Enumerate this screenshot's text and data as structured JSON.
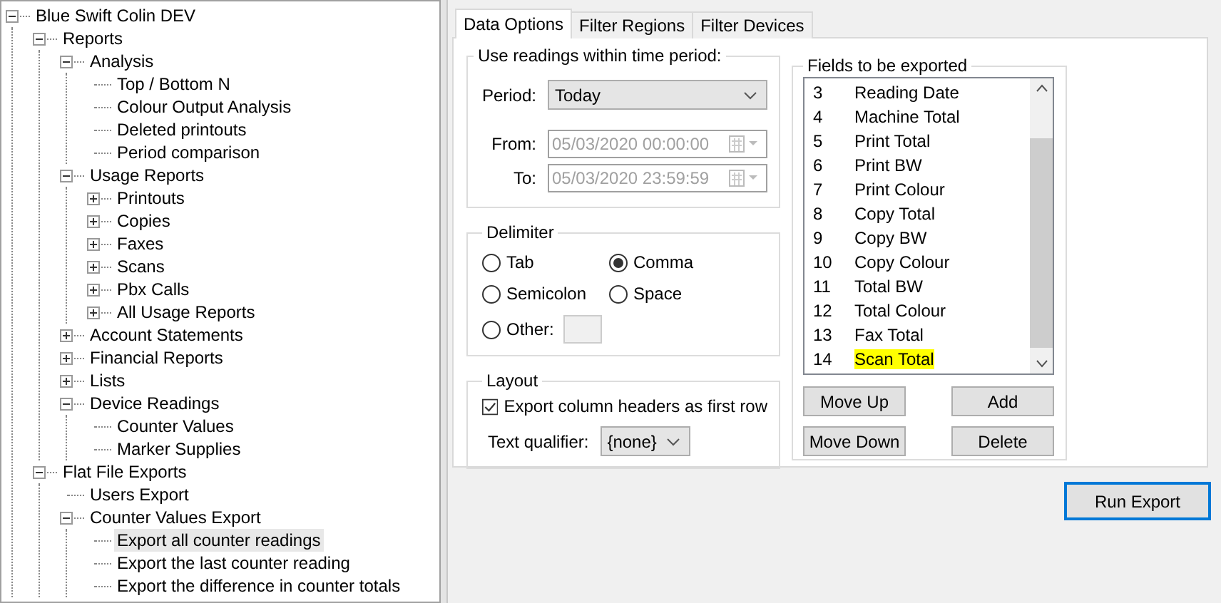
{
  "tree": {
    "label": "Blue Swift Colin DEV",
    "expanded": true,
    "selected": false,
    "children": [
      {
        "label": "Reports",
        "expanded": true,
        "selected": false,
        "children": [
          {
            "label": "Analysis",
            "expanded": true,
            "selected": false,
            "children": [
              {
                "label": "Top / Bottom N",
                "selected": false
              },
              {
                "label": "Colour Output Analysis",
                "selected": false
              },
              {
                "label": "Deleted printouts",
                "selected": false
              },
              {
                "label": "Period comparison",
                "selected": false
              }
            ]
          },
          {
            "label": "Usage Reports",
            "expanded": true,
            "selected": false,
            "children": [
              {
                "label": "Printouts",
                "expanded": false,
                "selected": false
              },
              {
                "label": "Copies",
                "expanded": false,
                "selected": false
              },
              {
                "label": "Faxes",
                "expanded": false,
                "selected": false
              },
              {
                "label": "Scans",
                "expanded": false,
                "selected": false
              },
              {
                "label": "Pbx Calls",
                "expanded": false,
                "selected": false
              },
              {
                "label": "All Usage Reports",
                "expanded": false,
                "selected": false
              }
            ]
          },
          {
            "label": "Account Statements",
            "expanded": false,
            "selected": false
          },
          {
            "label": "Financial Reports",
            "expanded": false,
            "selected": false
          },
          {
            "label": "Lists",
            "expanded": false,
            "selected": false
          },
          {
            "label": "Device Readings",
            "expanded": true,
            "selected": false,
            "children": [
              {
                "label": "Counter Values",
                "selected": false
              },
              {
                "label": "Marker Supplies",
                "selected": false
              }
            ]
          }
        ]
      },
      {
        "label": "Flat File Exports",
        "expanded": true,
        "selected": false,
        "children": [
          {
            "label": "Users Export",
            "selected": false
          },
          {
            "label": "Counter Values Export",
            "expanded": true,
            "selected": false,
            "children": [
              {
                "label": "Export all counter readings",
                "selected": true
              },
              {
                "label": "Export the last counter reading",
                "selected": false
              },
              {
                "label": "Export the difference in counter totals",
                "selected": false
              }
            ]
          }
        ]
      }
    ]
  },
  "tabs": [
    {
      "label": "Data Options",
      "selected": true
    },
    {
      "label": "Filter Regions",
      "selected": false
    },
    {
      "label": "Filter Devices",
      "selected": false
    }
  ],
  "time_period": {
    "title": "Use readings within time period:",
    "period": {
      "label": "Period:",
      "value": "Today"
    },
    "from": {
      "label": "From:",
      "value": "05/03/2020 00:00:00",
      "disabled": true
    },
    "to": {
      "label": "To:",
      "value": "05/03/2020 23:59:59",
      "disabled": true
    }
  },
  "delimiter": {
    "title": "Delimiter",
    "options": [
      {
        "kind": "radio",
        "label": "Tab",
        "selected": false
      },
      {
        "kind": "radio",
        "label": "Comma",
        "selected": true
      },
      {
        "kind": "radio",
        "label": "Semicolon",
        "selected": false
      },
      {
        "kind": "radio",
        "label": "Space",
        "selected": false
      },
      {
        "kind": "other",
        "label": "Other:",
        "selected": false
      }
    ]
  },
  "layout": {
    "title": "Layout",
    "headers": {
      "label": "Export column headers as first row",
      "checked": true
    },
    "qualifier": {
      "label": "Text qualifier:",
      "value": "{none}"
    }
  },
  "fields": {
    "title": "Fields to be exported",
    "items": [
      {
        "number": "3",
        "name": "Reading Date",
        "highlighted": false
      },
      {
        "number": "4",
        "name": "Machine Total",
        "highlighted": false
      },
      {
        "number": "5",
        "name": "Print Total",
        "highlighted": false
      },
      {
        "number": "6",
        "name": "Print BW",
        "highlighted": false
      },
      {
        "number": "7",
        "name": "Print Colour",
        "highlighted": false
      },
      {
        "number": "8",
        "name": "Copy Total",
        "highlighted": false
      },
      {
        "number": "9",
        "name": "Copy BW",
        "highlighted": false
      },
      {
        "number": "10",
        "name": "Copy Colour",
        "highlighted": false
      },
      {
        "number": "11",
        "name": "Total BW",
        "highlighted": false
      },
      {
        "number": "12",
        "name": "Total Colour",
        "highlighted": false
      },
      {
        "number": "13",
        "name": "Fax Total",
        "highlighted": false
      },
      {
        "number": "14",
        "name": "Scan Total",
        "highlighted": true
      }
    ],
    "buttons": [
      "Move Up",
      "Add",
      "Move Down",
      "Delete"
    ]
  },
  "run_button": "Run Export"
}
